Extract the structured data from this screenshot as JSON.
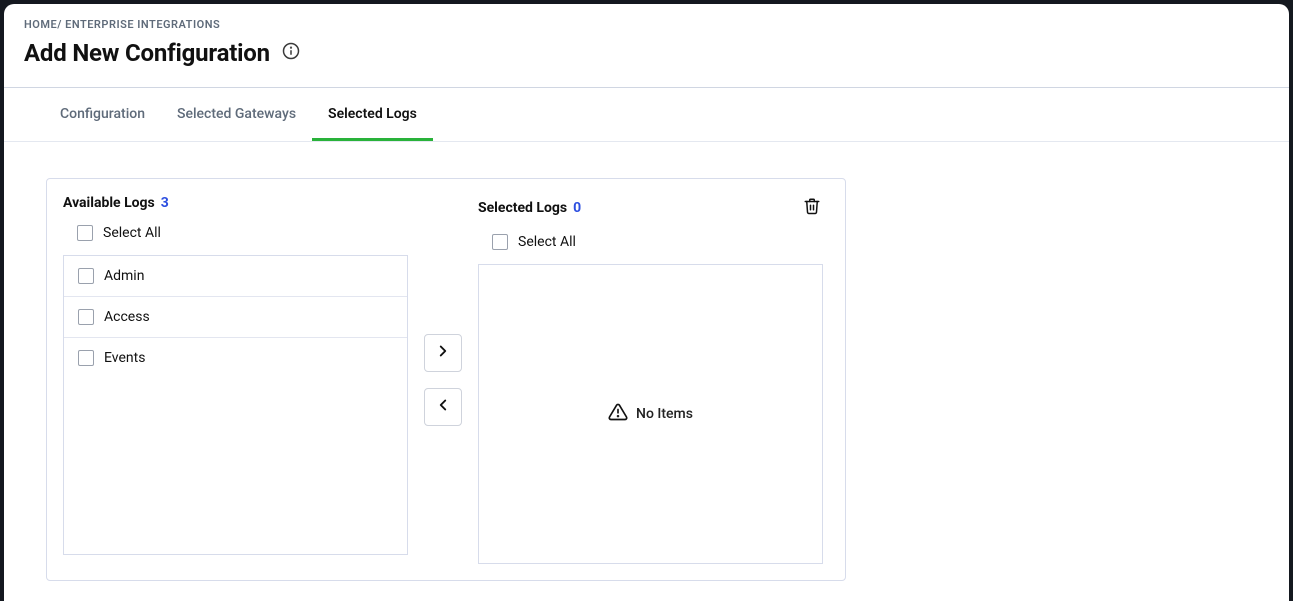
{
  "breadcrumb": {
    "home": "HOME",
    "sep": "/",
    "section": "ENTERPRISE INTEGRATIONS"
  },
  "page": {
    "title": "Add New Configuration"
  },
  "tabs": [
    {
      "label": "Configuration",
      "active": false
    },
    {
      "label": "Selected Gateways",
      "active": false
    },
    {
      "label": "Selected Logs",
      "active": true
    }
  ],
  "transfer": {
    "left": {
      "title": "Available Logs",
      "count": "3",
      "select_all": "Select All",
      "items": [
        {
          "label": "Admin"
        },
        {
          "label": "Access"
        },
        {
          "label": "Events"
        }
      ]
    },
    "right": {
      "title": "Selected Logs",
      "count": "0",
      "select_all": "Select All",
      "empty": "No Items"
    }
  }
}
